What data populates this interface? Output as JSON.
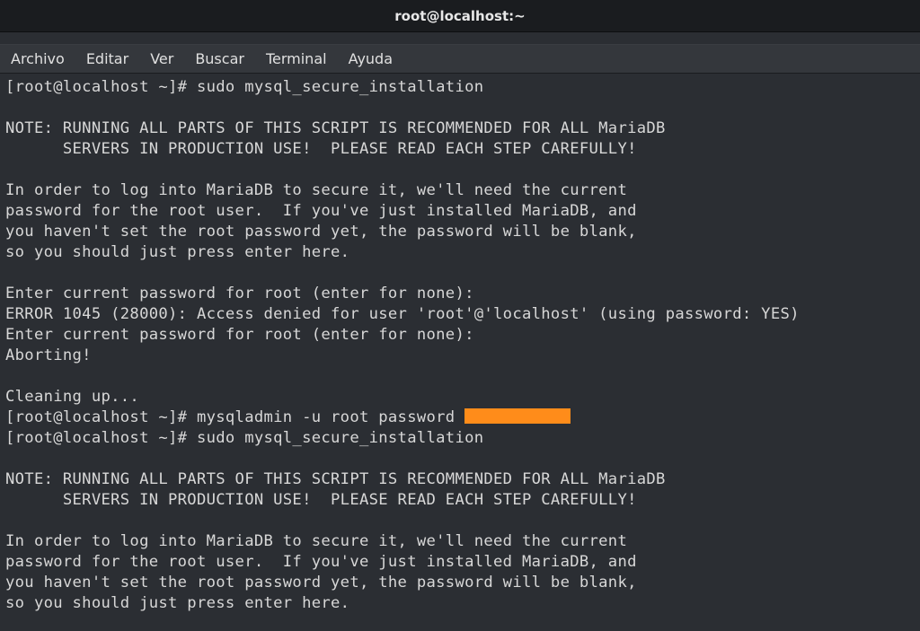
{
  "titlebar": {
    "title": "root@localhost:~"
  },
  "menu": {
    "archivo": "Archivo",
    "editar": "Editar",
    "ver": "Ver",
    "buscar": "Buscar",
    "terminal": "Terminal",
    "ayuda": "Ayuda"
  },
  "term": {
    "l01": "[root@localhost ~]# sudo mysql_secure_installation",
    "l02": "",
    "l03": "NOTE: RUNNING ALL PARTS OF THIS SCRIPT IS RECOMMENDED FOR ALL MariaDB",
    "l04": "      SERVERS IN PRODUCTION USE!  PLEASE READ EACH STEP CAREFULLY!",
    "l05": "",
    "l06": "In order to log into MariaDB to secure it, we'll need the current",
    "l07": "password for the root user.  If you've just installed MariaDB, and",
    "l08": "you haven't set the root password yet, the password will be blank,",
    "l09": "so you should just press enter here.",
    "l10": "",
    "l11": "Enter current password for root (enter for none):",
    "l12": "ERROR 1045 (28000): Access denied for user 'root'@'localhost' (using password: YES)",
    "l13": "Enter current password for root (enter for none):",
    "l14": "Aborting!",
    "l15": "",
    "l16": "Cleaning up...",
    "l17a": "[root@localhost ~]# mysqladmin -u root password ",
    "l18": "[root@localhost ~]# sudo mysql_secure_installation",
    "l19": "",
    "l20": "NOTE: RUNNING ALL PARTS OF THIS SCRIPT IS RECOMMENDED FOR ALL MariaDB",
    "l21": "      SERVERS IN PRODUCTION USE!  PLEASE READ EACH STEP CAREFULLY!",
    "l22": "",
    "l23": "In order to log into MariaDB to secure it, we'll need the current",
    "l24": "password for the root user.  If you've just installed MariaDB, and",
    "l25": "you haven't set the root password yet, the password will be blank,",
    "l26": "so you should just press enter here."
  }
}
